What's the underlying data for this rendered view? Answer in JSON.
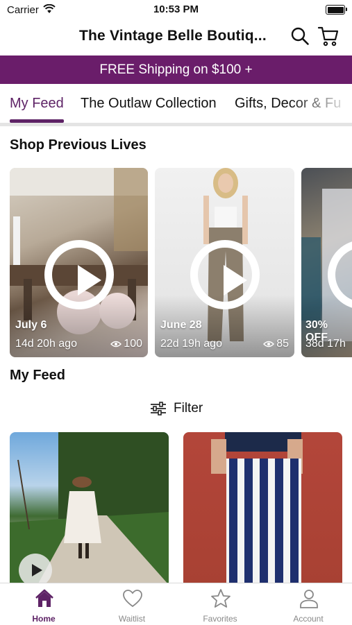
{
  "status_bar": {
    "carrier": "Carrier",
    "time": "10:53 PM"
  },
  "header": {
    "title": "The Vintage Belle Boutiq..."
  },
  "banner": {
    "text": "FREE Shipping on $100 +"
  },
  "tabs": [
    {
      "label": "My Feed",
      "active": true
    },
    {
      "label": "The Outlaw Collection",
      "active": false
    },
    {
      "label": "Gifts, Decor & Fu",
      "active": false
    }
  ],
  "previous_lives": {
    "title": "Shop Previous Lives",
    "cards": [
      {
        "date": "July 6",
        "ago": "14d 20h ago",
        "views": "100"
      },
      {
        "date": "June 28",
        "ago": "22d 19h ago",
        "views": "85"
      },
      {
        "date": "30% OFF",
        "ago": "38d 17h",
        "views": ""
      }
    ]
  },
  "my_feed": {
    "title": "My Feed",
    "filter_label": "Filter"
  },
  "bottom_nav": [
    {
      "label": "Home",
      "icon": "home-icon",
      "active": true
    },
    {
      "label": "Waitlist",
      "icon": "heart-icon",
      "active": false
    },
    {
      "label": "Favorites",
      "icon": "star-icon",
      "active": false
    },
    {
      "label": "Account",
      "icon": "person-icon",
      "active": false
    }
  ],
  "colors": {
    "accent": "#5e2366",
    "banner": "#6a1d6a"
  }
}
